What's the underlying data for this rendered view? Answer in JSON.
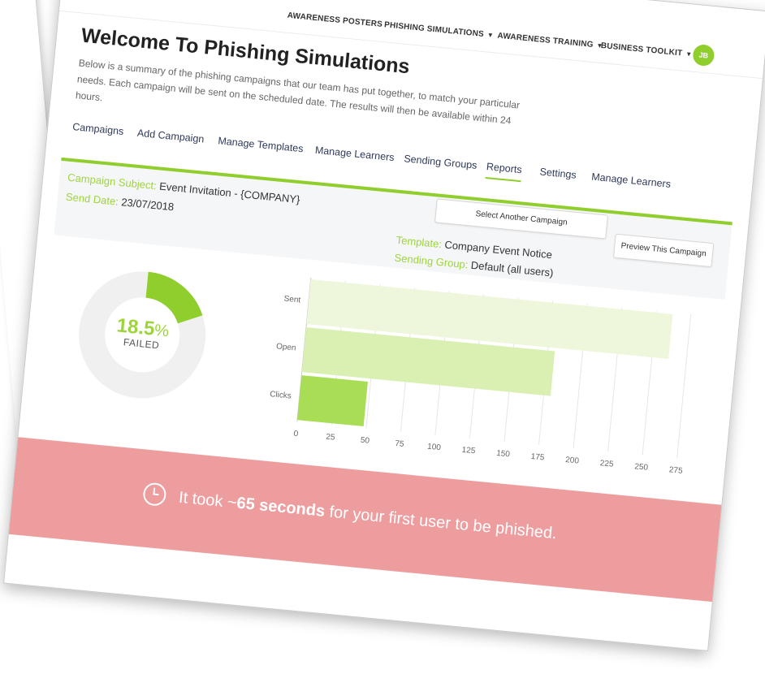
{
  "nav": {
    "items": [
      {
        "label": "AWARENESS POSTERS",
        "dropdown": false
      },
      {
        "label": "PHISHING SIMULATIONS",
        "dropdown": true
      },
      {
        "label": "AWARENESS TRAINING",
        "dropdown": true
      },
      {
        "label": "BUSINESS TOOLKIT",
        "dropdown": true
      }
    ],
    "avatar_initials": "JB"
  },
  "page": {
    "title": "Welcome To Phishing Simulations",
    "intro": "Below is a summary of the phishing campaigns that our team has put together, to match your particular needs. Each campaign will be sent on the scheduled date. The results will then be available within 24 hours."
  },
  "tabs": [
    {
      "label": "Campaigns"
    },
    {
      "label": "Add Campaign"
    },
    {
      "label": "Manage Templates"
    },
    {
      "label": "Manage Learners"
    },
    {
      "label": "Sending Groups"
    },
    {
      "label": "Reports",
      "active": true
    },
    {
      "label": "Settings"
    },
    {
      "label": "Manage Learners"
    }
  ],
  "campaign": {
    "subject_label": "Campaign Subject:",
    "subject_value": "Event Invitation - {COMPANY}",
    "send_date_label": "Send Date:",
    "send_date_value": "23/07/2018",
    "template_label": "Template:",
    "template_value": "Company Event Notice",
    "group_label": "Sending Group:",
    "group_value": "Default (all users)",
    "select_button": "Select Another Campaign",
    "preview_button": "Preview This Campaign"
  },
  "summary": {
    "failed_number": "18.5",
    "failed_percent_sign": "%",
    "failed_label": "FAILED",
    "failed_fraction": 0.185
  },
  "banner": {
    "prefix": "It took ~",
    "highlight": "65 seconds",
    "suffix": " for your first user to be phished."
  },
  "colors": {
    "accent": "#8fce2c",
    "banner": "#ee9d9f",
    "bar_sent": "#eef7dc",
    "bar_open": "#d9f0b2",
    "bar_clicks": "#a9dd56"
  },
  "chart_data": {
    "type": "bar",
    "orientation": "horizontal",
    "categories": [
      "Sent",
      "Open",
      "Clicks"
    ],
    "values": [
      262,
      180,
      48
    ],
    "xlim": [
      0,
      275
    ],
    "xticks": [
      0,
      25,
      50,
      75,
      100,
      125,
      150,
      175,
      200,
      225,
      250,
      275
    ],
    "grid": true
  }
}
